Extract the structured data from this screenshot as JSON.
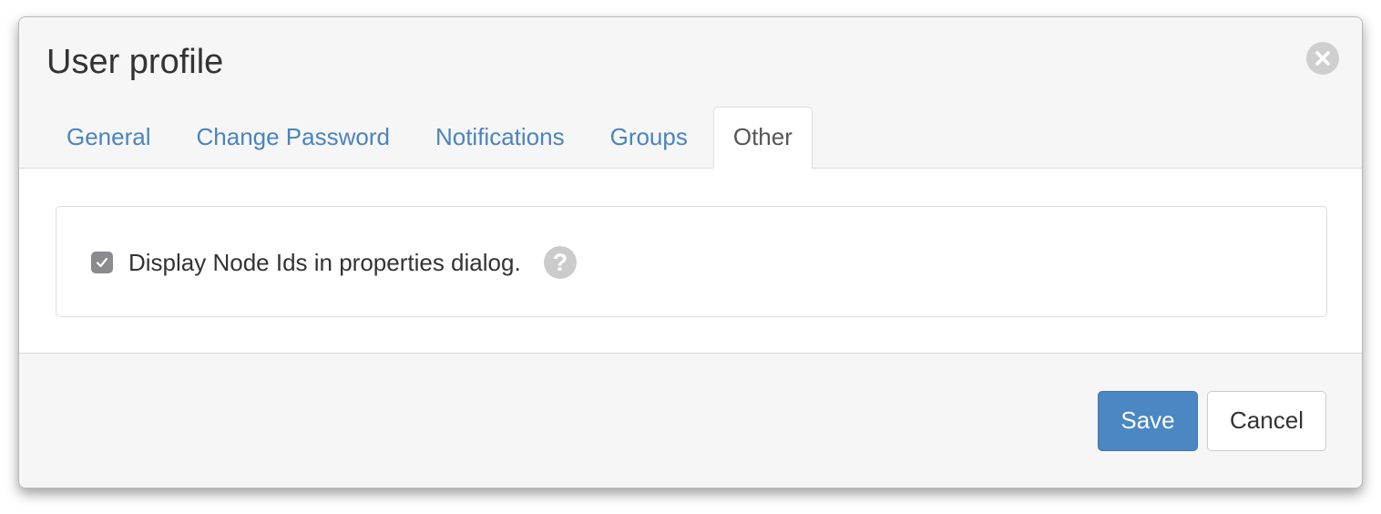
{
  "dialog": {
    "title": "User profile",
    "close_icon": "close-circle-icon"
  },
  "tabs": [
    {
      "label": "General",
      "active": false
    },
    {
      "label": "Change Password",
      "active": false
    },
    {
      "label": "Notifications",
      "active": false
    },
    {
      "label": "Groups",
      "active": false
    },
    {
      "label": "Other",
      "active": true
    }
  ],
  "other_tab": {
    "checkbox_label": "Display Node Ids in properties dialog.",
    "checkbox_checked": true,
    "help_icon": "question-circle-icon",
    "help_glyph": "?"
  },
  "footer": {
    "save_label": "Save",
    "cancel_label": "Cancel"
  },
  "colors": {
    "accent": "#4a87c3",
    "tab_link": "#4a84bd",
    "checkbox": "#8a8a8f"
  }
}
